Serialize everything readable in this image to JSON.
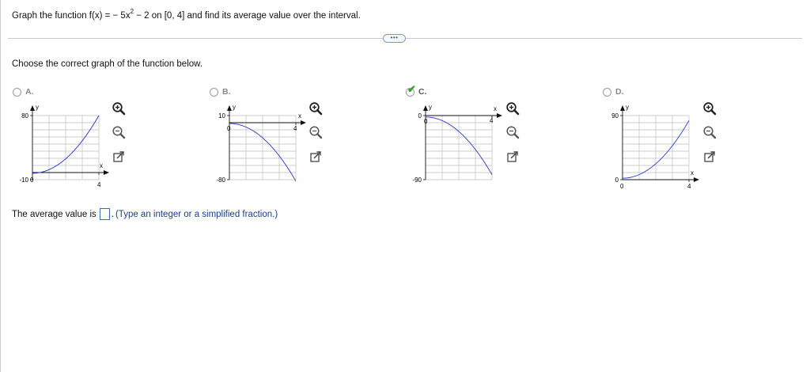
{
  "question": {
    "prefix": "Graph the function f(x) = − 5x",
    "exponent": "2",
    "suffix": " − 2 on [0, 4] and find its average value over the interval."
  },
  "more_button": {
    "label": "•••"
  },
  "instruction": "Choose the correct graph of the function below.",
  "options": [
    {
      "letter": "A.",
      "selected": false,
      "y_top_label": "80",
      "y_bottom_label": "-10",
      "x_label": "x",
      "y_label": "y",
      "x_tick_label": "4",
      "origin_label": "0"
    },
    {
      "letter": "B.",
      "selected": false,
      "y_top_label": "10",
      "y_bottom_label": "-80",
      "x_label": "x",
      "y_label": "y",
      "x_tick_label": "4",
      "origin_label": "0"
    },
    {
      "letter": "C.",
      "selected": true,
      "y_top_label": "0",
      "y_bottom_label": "-90",
      "x_label": "x",
      "y_label": "y",
      "x_tick_label": "4",
      "origin_label": "0"
    },
    {
      "letter": "D.",
      "selected": false,
      "y_top_label": "90",
      "y_bottom_label": "0",
      "x_label": "x",
      "y_label": "y",
      "x_tick_label": "4",
      "origin_label": "0"
    }
  ],
  "tools": [
    "zoom-in-icon",
    "zoom-out-icon",
    "popout-icon"
  ],
  "answer": {
    "prefix": "The average value is",
    "value": "",
    "suffix": ".",
    "hint": "(Type an integer or a simplified fraction.)"
  },
  "colors": {
    "curve": "#2233cc",
    "check": "#3a9c2e",
    "accent": "#2b5fa6"
  }
}
